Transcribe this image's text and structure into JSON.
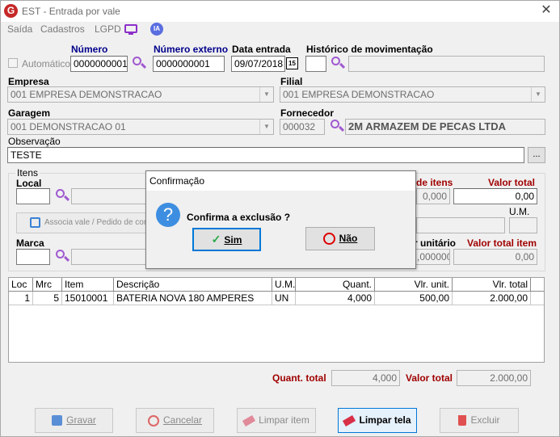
{
  "window": {
    "title": "EST - Entrada por vale",
    "app_icon": "G",
    "close": "✕"
  },
  "menu": [
    "Saída",
    "Cadastros",
    "LGPD",
    "IA"
  ],
  "header": {
    "automatico_label": "Automático",
    "numero_label": "Número",
    "numero_value": "0000000001",
    "numero_externo_label": "Número externo",
    "numero_externo_value": "0000000001",
    "data_entrada_label": "Data entrada",
    "data_entrada_value": "09/07/2018",
    "calendar_glyph": "15",
    "historico_label": "Histórico de movimentação",
    "historico_code": "",
    "historico_desc": "",
    "empresa_label": "Empresa",
    "empresa_value": "001 EMPRESA DEMONSTRACAO",
    "filial_label": "Filial",
    "filial_value": "001 EMPRESA DEMONSTRACAO",
    "garagem_label": "Garagem",
    "garagem_value": "001 DEMONSTRACAO 01",
    "fornecedor_label": "Fornecedor",
    "fornecedor_code": "000032",
    "fornecedor_name": "2M ARMAZEM DE PECAS LTDA",
    "observacao_label": "Observação",
    "observacao_value": "TESTE",
    "ellipsis": "..."
  },
  "itens": {
    "group_label": "Itens",
    "local_label": "Local",
    "qtd_itens_label": "de itens",
    "qtd_itens_value": "0,000",
    "valor_total_label": "Valor total",
    "valor_total_value": "0,00",
    "associa_label": "Associa vale / Pedido de com",
    "um_label": "U.M.",
    "marca_label": "Marca",
    "valor_unitario_label": "r unitário",
    "valor_unitario_value": ",0000000",
    "valor_total_item_label": "Valor total item",
    "valor_total_item_value": "0,00"
  },
  "table": {
    "columns": [
      "Loc",
      "Mrc",
      "Item",
      "Descrição",
      "U.M.",
      "Quant.",
      "Vlr. unit.",
      "Vlr. total"
    ],
    "rows": [
      [
        "1",
        "5",
        "15010001",
        "BATERIA NOVA 180 AMPERES",
        "UN",
        "4,000",
        "500,00",
        "2.000,00"
      ]
    ]
  },
  "totals": {
    "quant_total_label": "Quant. total",
    "quant_total_value": "4,000",
    "valor_total_label": "Valor total",
    "valor_total_value": "2.000,00"
  },
  "buttons": {
    "gravar": "Gravar",
    "cancelar": "Cancelar",
    "limpar_item": "Limpar item",
    "limpar_tela": "Limpar tela",
    "excluir": "Excluir"
  },
  "dialog": {
    "title": "Confirmação",
    "message": "Confirma a exclusão ?",
    "yes": "Sim",
    "no": "Não",
    "question_glyph": "?"
  }
}
